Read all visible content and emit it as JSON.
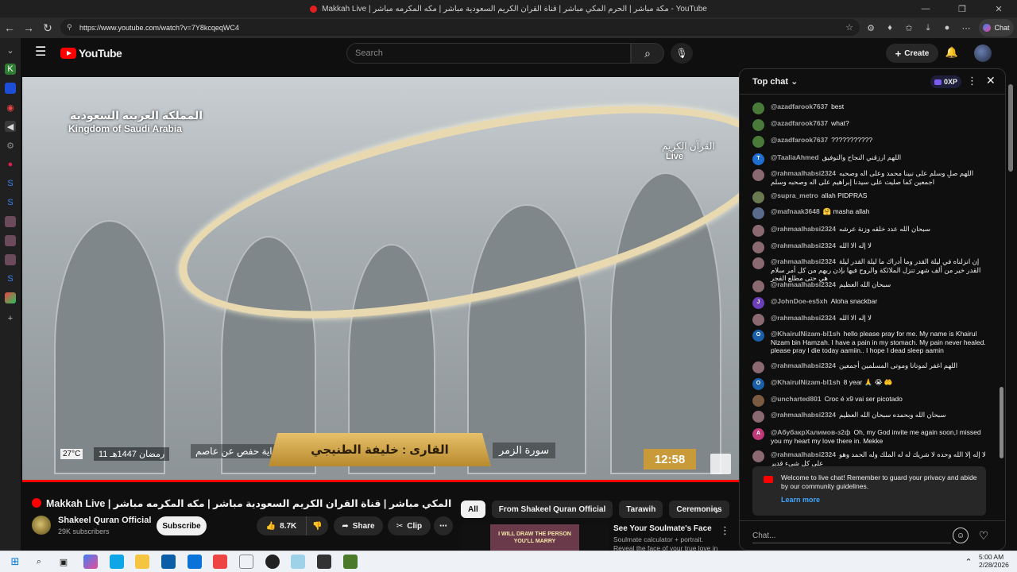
{
  "window": {
    "title": "Makkah Live | مكة مباشر | الحرم المكي مباشر | قناة القران الكريم السعودية مباشر | مكه المكرمه مباشر - YouTube"
  },
  "browser": {
    "url": "https://www.youtube.com/watch?v=7Y8kcqeqWC4",
    "chat_label": "Chat"
  },
  "masthead": {
    "logo_text": "YouTube",
    "search_placeholder": "Search",
    "create_label": "Create"
  },
  "video_overlay": {
    "ksa_ar": "المملكة العربية السعودية",
    "ksa_en": "Kingdom of Saudi Arabia",
    "channel_ar": "القرآن الكريم",
    "live": "Live",
    "reciter": "القارى : خليفة الطنيجي",
    "riwaya": "رواية حفص عن عاصم",
    "surah": "سورة الزمر",
    "hijri": "11 رمضان 1447هـ",
    "temperature": "27°C",
    "clock": "12:58"
  },
  "video_info": {
    "title": "Makkah Live | مكة مباشر | الحرم المكي مباشر | قناة القران الكريم السعودية مباشر | مكه المكرمه مباشر",
    "channel": "Shakeel Quran Official",
    "subscribers": "29K subscribers",
    "subscribe_label": "Subscribe",
    "likes": "8.7K",
    "share_label": "Share",
    "clip_label": "Clip"
  },
  "chips": [
    "All",
    "From Shakeel Quran Official",
    "Tarawih",
    "Ceremonies"
  ],
  "recommendation": {
    "thumb_text": "I WILL DRAW THE PERSON YOU'LL MARRY",
    "title": "See Your Soulmate's Face",
    "subtitle": "Soulmate calculator + portrait.",
    "subtitle2": "Reveal the face of your true love in"
  },
  "chat": {
    "mode": "Top chat",
    "xp": "0XP",
    "welcome_text": "Welcome to live chat! Remember to guard your privacy and abide by our community guidelines.",
    "learn_more": "Learn more",
    "input_placeholder": "Chat...",
    "messages": [
      {
        "author": "@azadfarook7637",
        "text": "best",
        "avatar": "",
        "color": "#4a7a3a"
      },
      {
        "author": "@azadfarook7637",
        "text": "what?",
        "avatar": "",
        "color": "#4a7a3a"
      },
      {
        "author": "@azadfarook7637",
        "text": "???????????",
        "avatar": "",
        "color": "#4a7a3a"
      },
      {
        "author": "@TaaliaAhmed",
        "text": "اللهم ارزقني النجاح والتوفيق",
        "avatar": "T",
        "color": "#1f6fd1"
      },
      {
        "author": "@rahmaalhabsi2324",
        "text": "اللهم صلِ وسلم على نبينا محمد وعلى اله وصحبه اجمعين كما صليت على سيدنا إبراهيم على اله وصحبه وسلم",
        "avatar": "",
        "color": "#8a6a70"
      },
      {
        "author": "@supra_metro",
        "text": "allah PIDPRAS",
        "avatar": "",
        "color": "#6a7a50"
      },
      {
        "author": "@mafnaak3648",
        "text": "🤗 masha allah",
        "avatar": "",
        "color": "#5a6a8a"
      },
      {
        "author": "@rahmaalhabsi2324",
        "text": "سبحان الله عدد خلقه وزنة عرشه",
        "avatar": "",
        "color": "#8a6a70"
      },
      {
        "author": "@rahmaalhabsi2324",
        "text": "لا إله الا الله",
        "avatar": "",
        "color": "#8a6a70"
      },
      {
        "author": "@rahmaalhabsi2324",
        "text": "إن انزلناه في ليلة القدر وما أدراك ما ليلة القدر ليلة القدر خير من ألف شهر تنزل الملائكة والروح فيها بإذن ربهم من كل أمر سلام هي حتى مطلع الفجر",
        "avatar": "",
        "color": "#8a6a70"
      },
      {
        "author": "@rahmaalhabsi2324",
        "text": "سبحان الله العظيم",
        "avatar": "",
        "color": "#8a6a70"
      },
      {
        "author": "@JohnDoe-es5xh",
        "text": "Aloha snackbar",
        "avatar": "J",
        "color": "#6a3fb8"
      },
      {
        "author": "@rahmaalhabsi2324",
        "text": "لا إله الا الله",
        "avatar": "",
        "color": "#8a6a70"
      },
      {
        "author": "@KhairulNizam-bl1sh",
        "text": "hello please pray for me. My name is Khairul Nizam bin Hamzah. I have a pain in my stomach. My pain never healed. please pray I die today aamiin.. I hope I dead sleep aamin",
        "avatar": "O",
        "color": "#1a5fa8"
      },
      {
        "author": "@rahmaalhabsi2324",
        "text": "اللهم اغفر لموتانا وموتى المسلمين أجمعين",
        "avatar": "",
        "color": "#8a6a70"
      },
      {
        "author": "@KhairulNizam-bl1sh",
        "text": "8 year 🙏 😭 🤲",
        "avatar": "O",
        "color": "#1a5fa8"
      },
      {
        "author": "@uncharted801",
        "text": "Croc é x9 vai ser picotado",
        "avatar": "",
        "color": "#7a5a40"
      },
      {
        "author": "@rahmaalhabsi2324",
        "text": "سبحان الله وبحمده سبحان الله العظيم",
        "avatar": "",
        "color": "#8a6a70"
      },
      {
        "author": "@АбубакрХалимов-з2ф",
        "text": "Oh, my God invite me again soon,I missed you my heart my love there in. Mekke",
        "avatar": "A",
        "color": "#c0397a"
      },
      {
        "author": "@rahmaalhabsi2324",
        "text": "لا إله إلا الله وحده لا شريك له له الملك وله الحمد وهو على كل شيء قدير",
        "avatar": "",
        "color": "#8a6a70"
      }
    ]
  },
  "taskbar": {
    "time": "5:00 AM",
    "date": "2/28/2026"
  }
}
